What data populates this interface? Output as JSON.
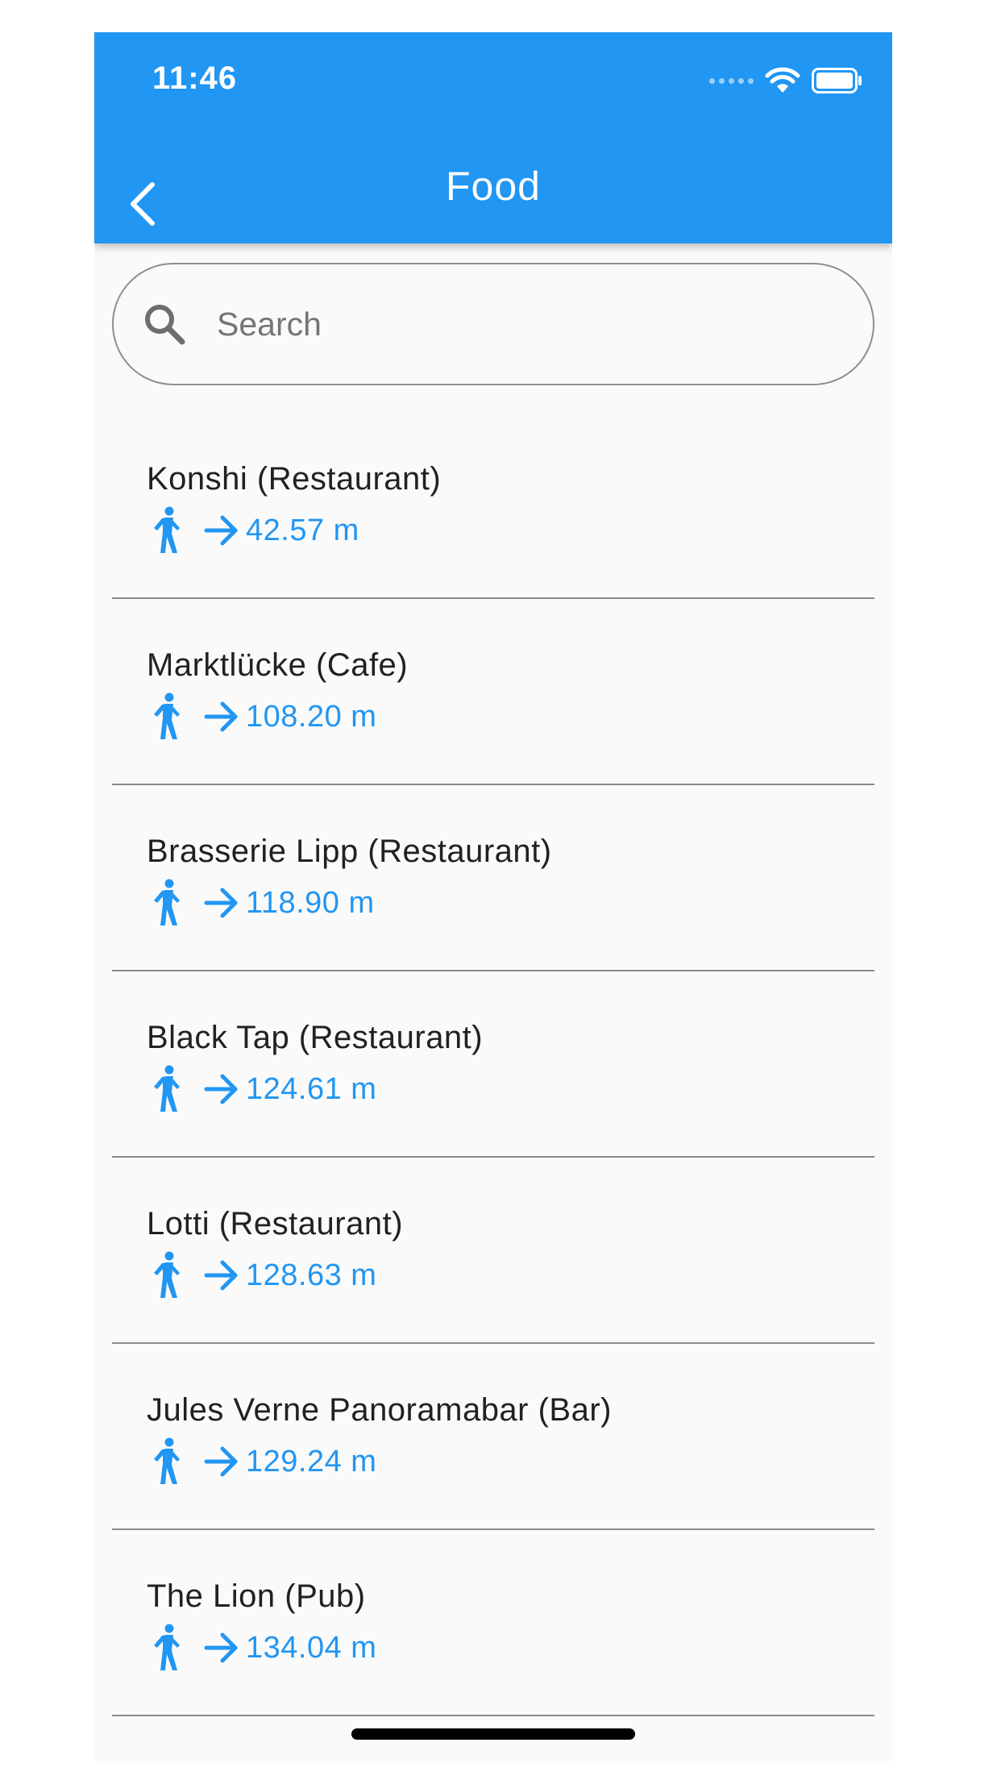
{
  "status_bar": {
    "time": "11:46"
  },
  "app_bar": {
    "title": "Food"
  },
  "search": {
    "placeholder": "Search",
    "value": ""
  },
  "colors": {
    "primary": "#2196f3",
    "background": "#fafafa",
    "text": "#212121"
  },
  "icons": {
    "back": "back-arrow-icon",
    "search": "search-icon",
    "walk": "directions-walk-icon",
    "arrow": "arrow-forward-icon"
  },
  "places": [
    {
      "name": "Konshi (Restaurant)",
      "distance": "42.57 m"
    },
    {
      "name": "Marktlücke (Cafe)",
      "distance": "108.20 m"
    },
    {
      "name": "Brasserie Lipp (Restaurant)",
      "distance": "118.90 m"
    },
    {
      "name": "Black Tap (Restaurant)",
      "distance": "124.61 m"
    },
    {
      "name": "Lotti (Restaurant)",
      "distance": "128.63 m"
    },
    {
      "name": "Jules Verne Panoramabar (Bar)",
      "distance": "129.24 m"
    },
    {
      "name": "The Lion (Pub)",
      "distance": "134.04 m"
    }
  ]
}
